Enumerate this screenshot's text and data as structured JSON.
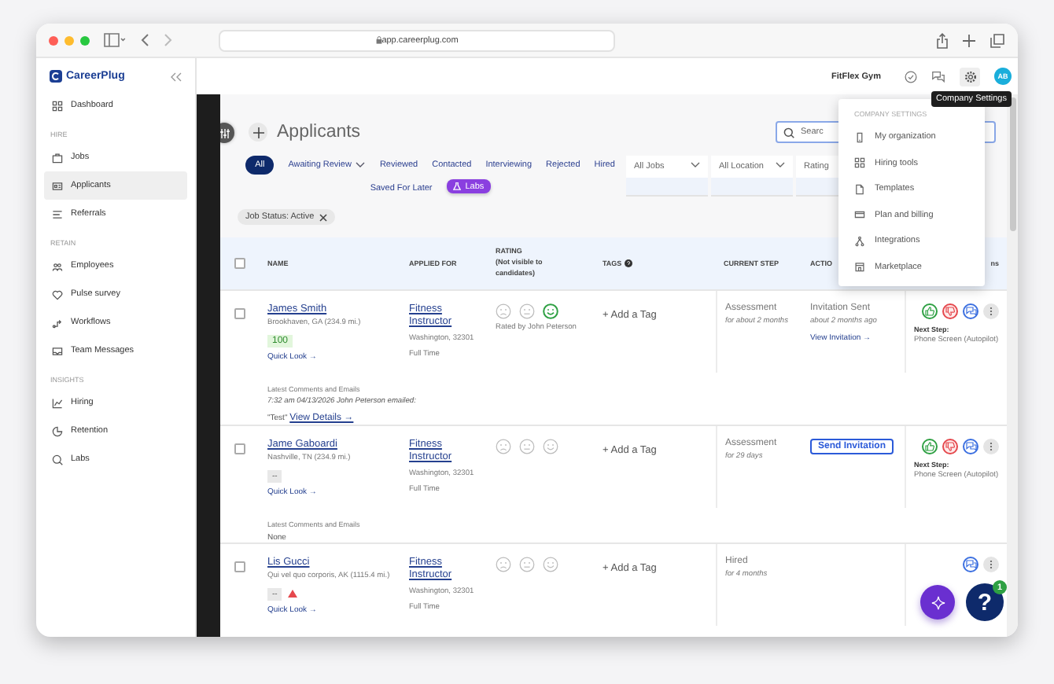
{
  "browser": {
    "url": "app.careerplug.com"
  },
  "sidebar": {
    "logo": "CareerPlug",
    "sections": [
      {
        "items": [
          {
            "label": "Dashboard",
            "selected": false
          }
        ]
      },
      {
        "heading": "HIRE",
        "items": [
          {
            "label": "Jobs",
            "selected": false
          },
          {
            "label": "Applicants",
            "selected": true
          },
          {
            "label": "Referrals",
            "selected": false
          }
        ]
      },
      {
        "heading": "RETAIN",
        "items": [
          {
            "label": "Employees",
            "selected": false
          },
          {
            "label": "Pulse survey",
            "selected": false
          },
          {
            "label": "Workflows",
            "selected": false
          },
          {
            "label": "Team Messages",
            "selected": false
          }
        ]
      },
      {
        "heading": "INSIGHTS",
        "items": [
          {
            "label": "Hiring",
            "selected": false
          },
          {
            "label": "Retention",
            "selected": false
          },
          {
            "label": "Labs",
            "selected": false
          }
        ]
      }
    ]
  },
  "header": {
    "company": "FitFlex Gym",
    "avatar": "AB",
    "tooltip": "Company Settings"
  },
  "page": {
    "title": "Applicants",
    "search_placeholder": "Searc",
    "tabs": [
      {
        "label": "All",
        "kind": "pill",
        "selected": true
      },
      {
        "label": "Awaiting Review",
        "kind": "dropdown",
        "selected": false
      },
      {
        "label": "Reviewed",
        "kind": "tab",
        "selected": false
      },
      {
        "label": "Contacted",
        "kind": "tab",
        "selected": false
      },
      {
        "label": "Interviewing",
        "kind": "tab",
        "selected": false
      },
      {
        "label": "Rejected",
        "kind": "tab",
        "selected": false
      },
      {
        "label": "Hired",
        "kind": "tab",
        "selected": false
      },
      {
        "label": "Saved For Later",
        "kind": "tab",
        "selected": false
      },
      {
        "label": "Labs",
        "kind": "labs",
        "selected": false
      }
    ],
    "filters": [
      "All Jobs",
      "All Location",
      "Rating"
    ],
    "chip": "Job Status: Active"
  },
  "table": {
    "header_checked": false,
    "columns": [
      {
        "label": "NAME"
      },
      {
        "label": "APPLIED FOR"
      },
      {
        "label": "RATING",
        "note": "(Not visible to candidates)"
      },
      {
        "label": "TAGS"
      },
      {
        "label": "CURRENT STEP"
      },
      {
        "label": "ACTIO"
      },
      {
        "label": "ns"
      }
    ],
    "rows": [
      {
        "checked": false,
        "name": "James Smith",
        "location": "Brookhaven, GA (234.9 mi.)",
        "score": {
          "text": "100",
          "good": true
        },
        "warning": false,
        "quick_look": "Quick Look →",
        "comments": {
          "heading": "Latest Comments and Emails",
          "meta": "7:32 am 04/13/2026 John Peterson emailed:",
          "text": "\"Test\"",
          "link": "View Details →"
        },
        "job": "Fitness Instructor",
        "job_location": "Washington, 32301",
        "job_type": "Full Time",
        "rating": [
          {
            "selected": false
          },
          {
            "selected": false
          },
          {
            "selected": true
          }
        ],
        "rated_by": "Rated by John Peterson",
        "tag": "+ Add a Tag",
        "step": "Assessment",
        "step_time": "for about 2 months",
        "action": {
          "kind": "status",
          "status": "Invitation Sent",
          "time": "about 2 months ago",
          "link": "View Invitation →"
        },
        "decision_buttons": true,
        "next_step": {
          "label": "Next Step:",
          "value": "Phone Screen (Autopilot)"
        }
      },
      {
        "checked": false,
        "name": "Jame Gaboardi",
        "location": "Nashville, TN (234.9 mi.)",
        "score": {
          "text": "--",
          "good": false
        },
        "warning": false,
        "quick_look": "Quick Look →",
        "comments": {
          "heading": "Latest Comments and Emails",
          "text": "None"
        },
        "job": "Fitness Instructor",
        "job_location": "Washington, 32301",
        "job_type": "Full Time",
        "rating": [
          {
            "selected": false
          },
          {
            "selected": false
          },
          {
            "selected": false
          }
        ],
        "tag": "+ Add a Tag",
        "step": "Assessment",
        "step_time": "for 29 days",
        "action": {
          "kind": "button",
          "label": "Send Invitation"
        },
        "decision_buttons": true,
        "next_step": {
          "label": "Next Step:",
          "value": "Phone Screen (Autopilot)"
        }
      },
      {
        "checked": false,
        "name": "Lis Gucci",
        "location": "Qui vel quo corporis, AK (1115.4 mi.)",
        "score": {
          "text": "--",
          "good": false
        },
        "warning": true,
        "quick_look": "Quick Look →",
        "job": "Fitness Instructor",
        "job_location": "Washington, 32301",
        "job_type": "Full Time",
        "rating": [
          {
            "selected": false
          },
          {
            "selected": false
          },
          {
            "selected": false
          }
        ],
        "tag": "+ Add a Tag",
        "step": "Hired",
        "step_time": "for 4 months",
        "decision_buttons": false
      }
    ]
  },
  "menu": {
    "heading": "COMPANY SETTINGS",
    "items": [
      "My organization",
      "Hiring tools",
      "Templates",
      "Plan and billing",
      "Integrations",
      "Marketplace"
    ]
  },
  "help": {
    "label": "?",
    "badge": "1"
  }
}
